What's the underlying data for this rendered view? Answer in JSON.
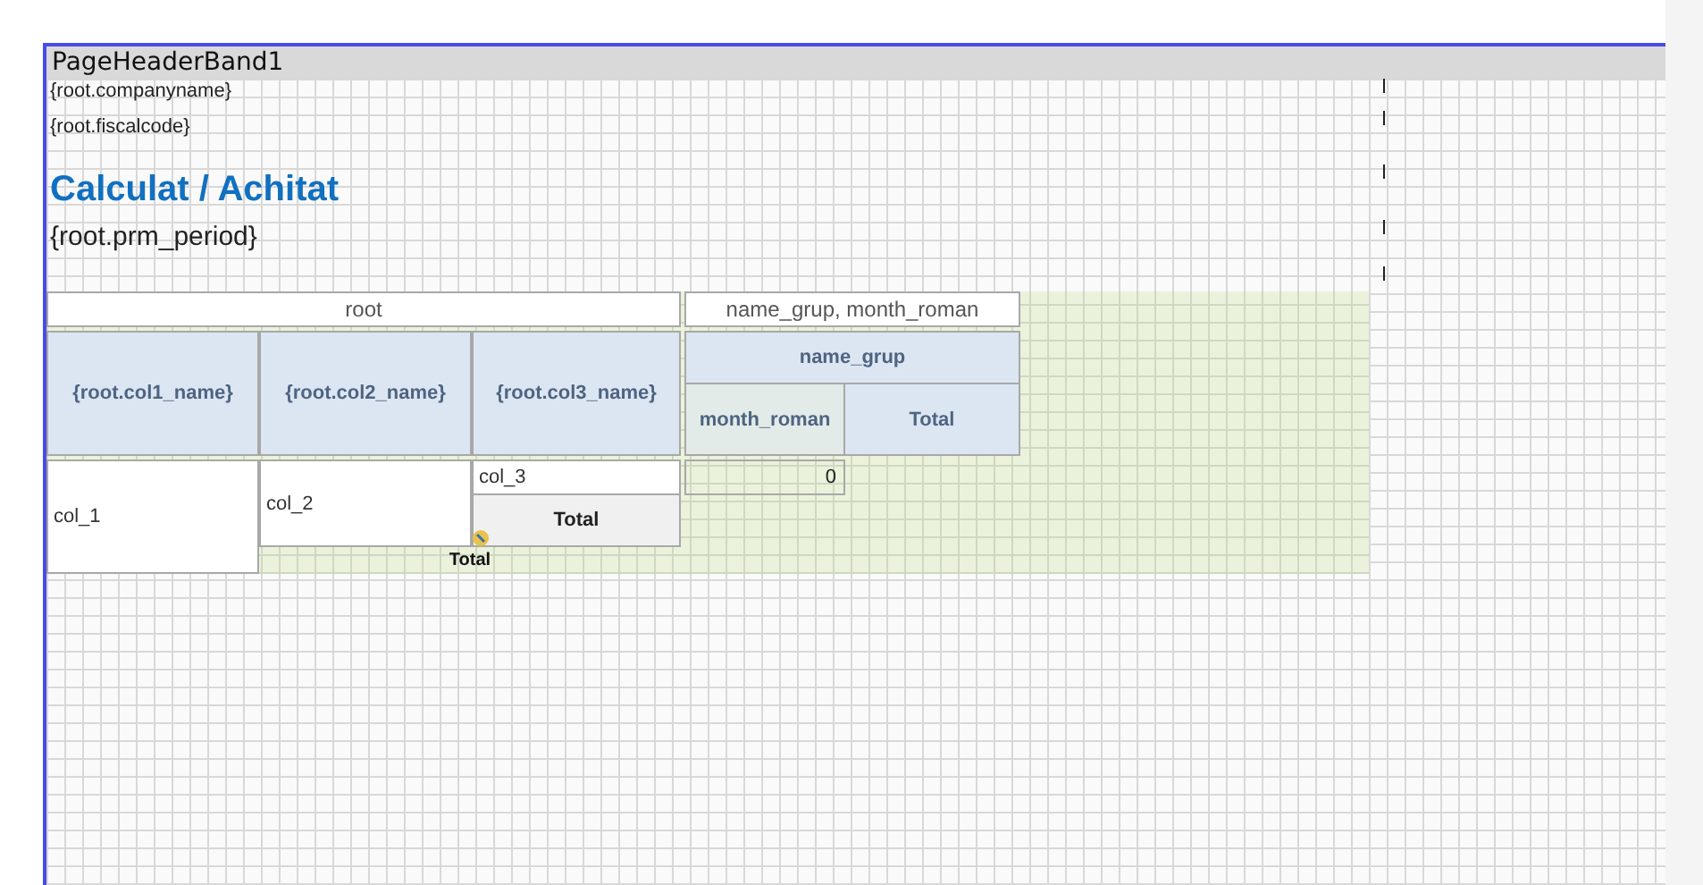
{
  "band": {
    "title": "PageHeaderBand1"
  },
  "header_fields": [
    {
      "kind": "small",
      "text": "{root.companyname}"
    },
    {
      "kind": "small",
      "text": "{root.fiscalcode}"
    },
    {
      "kind": "title",
      "text": "Calculat / Achitat"
    },
    {
      "kind": "period",
      "text": "{root.prm_period}"
    }
  ],
  "crosstab": {
    "row_caption": "root",
    "column_caption": "name_grup, month_roman",
    "row_headers": [
      "{root.col1_name}",
      "{root.col2_name}",
      "{root.col3_name}"
    ],
    "column_group": "name_grup",
    "column_subheaders": [
      "month_roman",
      "Total"
    ],
    "rows": [
      "col_1",
      "col_2",
      "col_3"
    ],
    "row_total": "Total",
    "grand_total": "Total",
    "value": "0"
  }
}
